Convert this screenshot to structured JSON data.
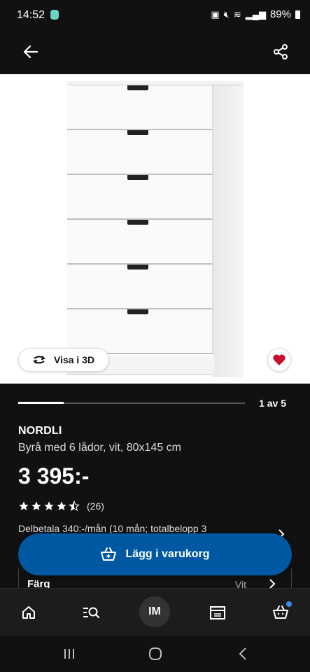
{
  "status_bar": {
    "time": "14:52",
    "battery": "89%"
  },
  "product": {
    "name": "NORDLI",
    "description": "Byrå med 6 lådor, vit, 80x145 cm",
    "price": "3 395:-",
    "rating_stars": 4.5,
    "rating_count": "(26)",
    "installment": "Delbetala 340:-/mån (10 mån; totalbelopp 3"
  },
  "gallery": {
    "page_indicator": "1 av 5",
    "progress_fraction": 0.2,
    "visa_3d_label": "Visa i 3D"
  },
  "actions": {
    "add_to_cart_label": "Lägg i varukorg"
  },
  "color_option": {
    "label": "Färg",
    "value": "Vit"
  },
  "bottom_nav": {
    "avatar_initials": "IM",
    "items": [
      "home-icon",
      "search-list-icon",
      "avatar",
      "store-icon",
      "cart-icon"
    ]
  },
  "colors": {
    "brand_blue": "#0058a3",
    "favorite_red": "#c8102e",
    "background": "#111111"
  }
}
